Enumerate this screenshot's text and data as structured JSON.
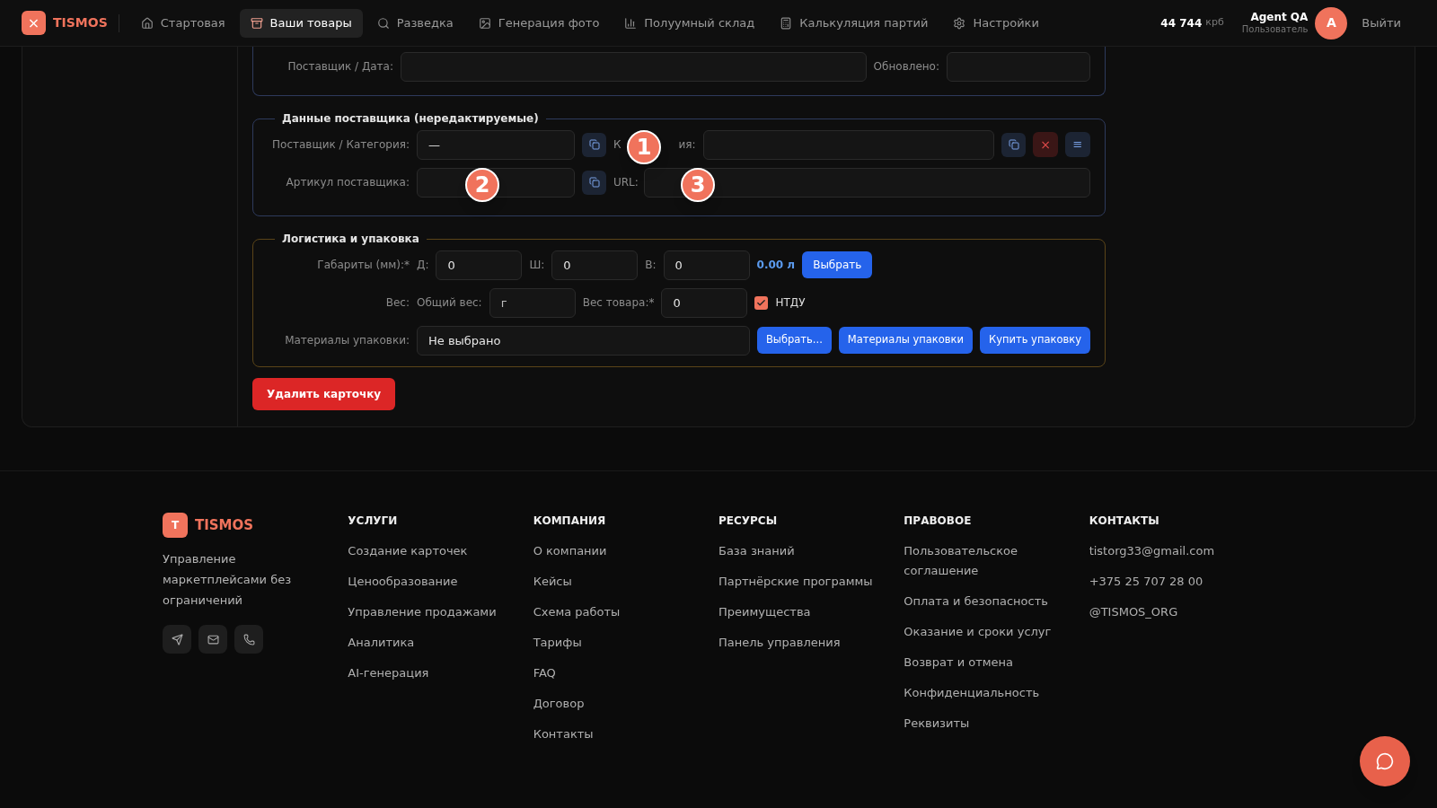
{
  "nav": {
    "logo": "TISMOS",
    "logo_icon": "×",
    "items": [
      {
        "label": "Стартовая",
        "selected": false
      },
      {
        "label": "Ваши товары",
        "selected": true
      },
      {
        "label": "Разведка",
        "selected": false
      },
      {
        "label": "Генерация фото",
        "selected": false
      },
      {
        "label": "Полуумный склад",
        "selected": false
      },
      {
        "label": "Калькуляция партий",
        "selected": false
      },
      {
        "label": "Настройки",
        "selected": false
      }
    ],
    "balance": {
      "amount": "44 744",
      "unit": "крб"
    },
    "user": {
      "name": "Agent QA",
      "role": "Пользователь",
      "initial": "A"
    },
    "logout": "Выйти"
  },
  "top_section": {
    "supplier_date_label": "Поставщик / Дата:",
    "updated_label": "Обновлено:"
  },
  "supplier_section": {
    "title": "Данные поставщика (нередактируемые)",
    "supplier_label": "Поставщик / Категория:",
    "supplier_value": "—",
    "category_label_start": "К",
    "category_label_end": "ия:",
    "article_label": "Артикул поставщика:",
    "url_label": "URL:",
    "remove_icon": "×",
    "menu_icon": "≡"
  },
  "logistics_section": {
    "title": "Логистика и упаковка",
    "dims_label": "Габариты (мм):*",
    "dims": [
      {
        "label": "Д:",
        "value": "0"
      },
      {
        "label": "Ш:",
        "value": "0"
      },
      {
        "label": "В:",
        "value": "0"
      }
    ],
    "volume": "0.00 л",
    "choose": "Выбрать",
    "weight_label": "Вес:",
    "total_weight_label": "Общий вес:",
    "total_weight_placeholder": "г",
    "item_weight_label": "Вес товара:*",
    "item_weight_value": "0",
    "ntdu": {
      "label": "НТДУ",
      "checked": true
    },
    "materials_label": "Материалы упаковки:",
    "materials_value": "Не выбрано",
    "buttons": [
      "Выбрать...",
      "Материалы упаковки",
      "Купить упаковку"
    ]
  },
  "delete_button": "Удалить карточку",
  "markers": [
    "1",
    "2",
    "3"
  ],
  "footer": {
    "logo_letter": "T",
    "logo": "TISMOS",
    "tagline": "Управление маркетплейсами без ограничений",
    "columns": [
      {
        "title": "УСЛУГИ",
        "links": [
          "Создание карточек",
          "Ценообразование",
          "Управление продажами",
          "Аналитика",
          "AI-генерация"
        ]
      },
      {
        "title": "КОМПАНИЯ",
        "links": [
          "О компании",
          "Кейсы",
          "Схема работы",
          "Тарифы",
          "FAQ",
          "Договор",
          "Контакты"
        ]
      },
      {
        "title": "РЕСУРСЫ",
        "links": [
          "База знаний",
          "Партнёрские программы",
          "Преимущества",
          "Панель управления"
        ]
      },
      {
        "title": "ПРАВОВОЕ",
        "links": [
          "Пользовательское соглашение",
          "Оплата и безопасность",
          "Оказание и сроки услуг",
          "Возврат и отмена",
          "Конфиденциальность",
          "Реквизиты"
        ]
      },
      {
        "title": "КОНТАКТЫ",
        "links": [
          "tistorg33@gmail.com",
          "+375 25 707 28 00",
          "@TISMOS_ORG"
        ]
      }
    ]
  }
}
